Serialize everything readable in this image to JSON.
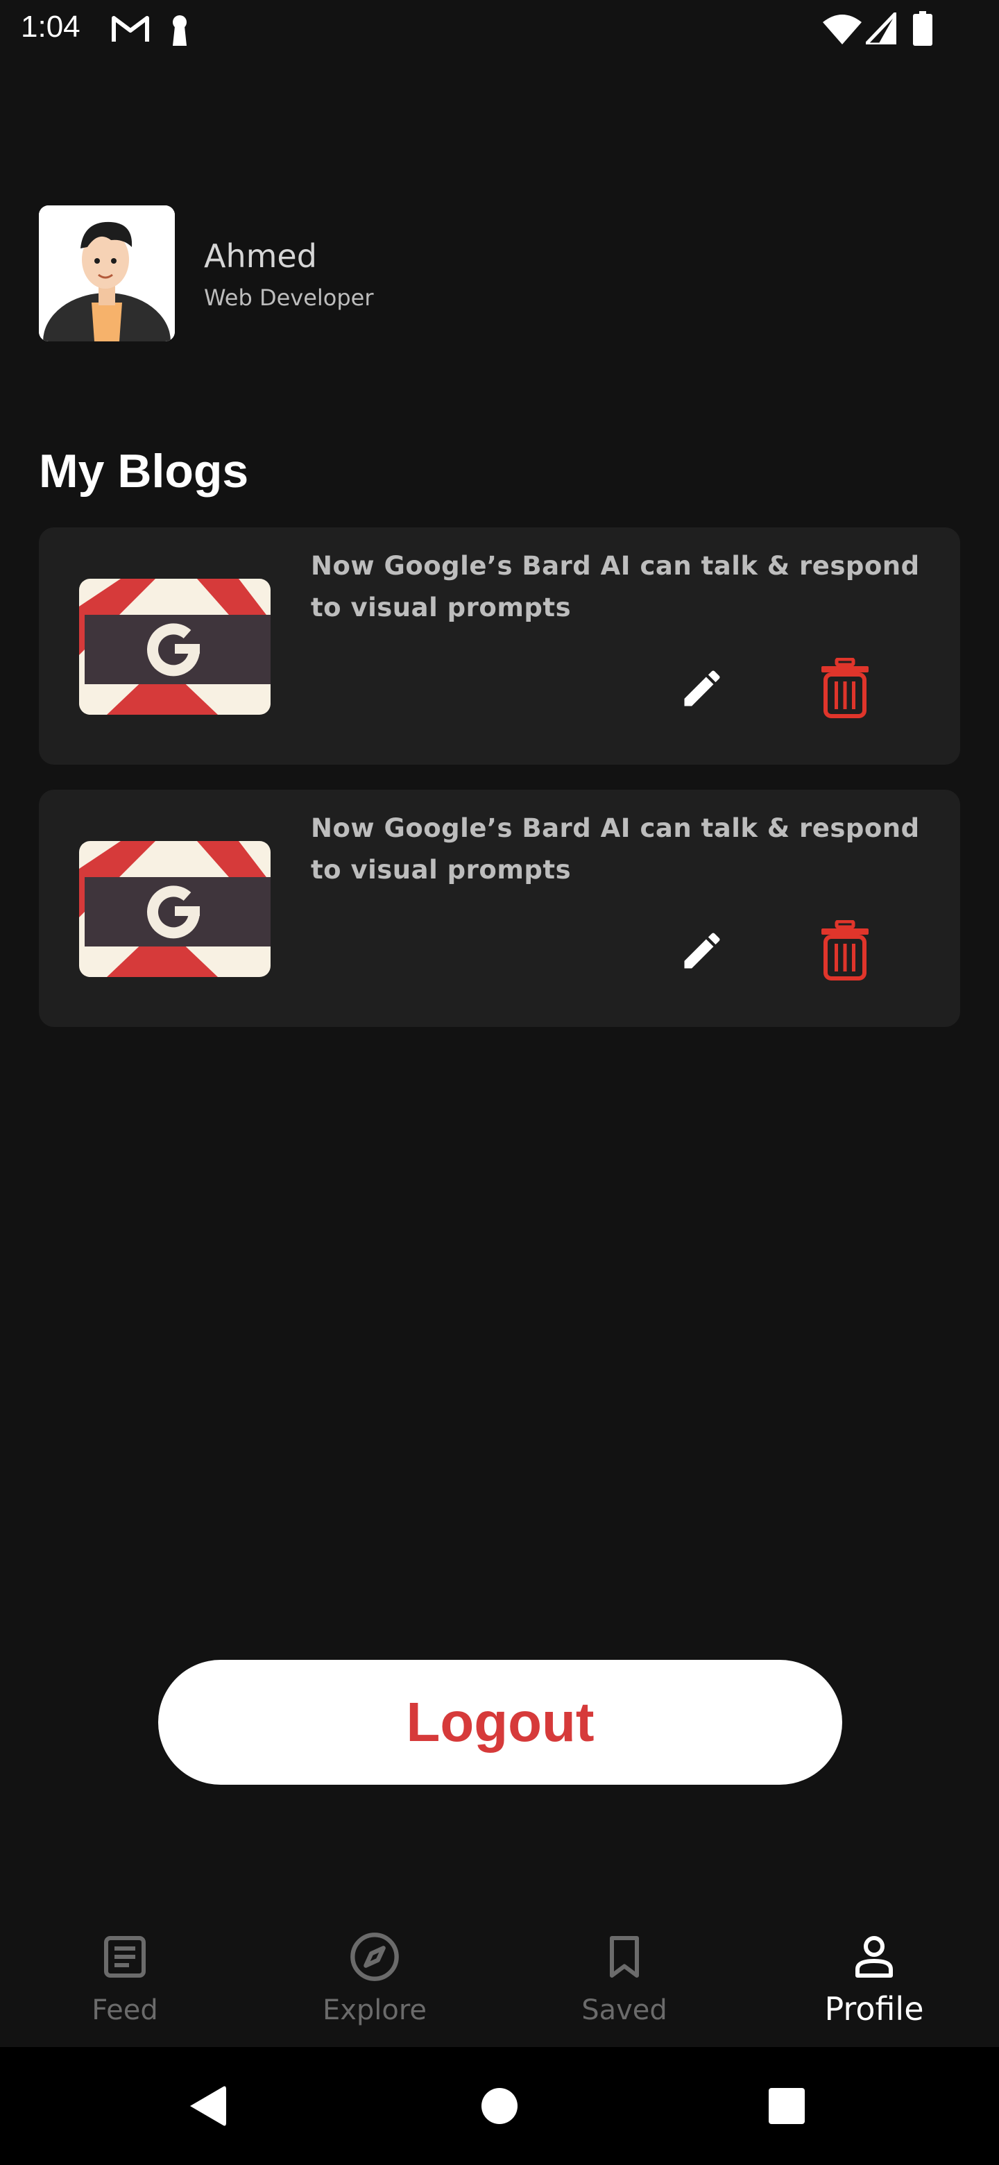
{
  "status_bar": {
    "time": "1:04",
    "icons": [
      "gmail-icon",
      "keyhole-icon",
      "wifi-icon",
      "signal-icon",
      "battery-icon"
    ]
  },
  "profile": {
    "name": "Ahmed",
    "role": "Web Developer",
    "avatar_icon": "user-avatar"
  },
  "section": {
    "title": "My Blogs"
  },
  "blogs": [
    {
      "title": "Now Google’s Bard AI can talk & respond to visual prompts",
      "thumbnail_icon": "google-g-logo",
      "edit_icon": "pencil-icon",
      "delete_icon": "trash-icon"
    },
    {
      "title": "Now Google’s Bard AI can talk & respond to visual prompts",
      "thumbnail_icon": "google-g-logo",
      "edit_icon": "pencil-icon",
      "delete_icon": "trash-icon"
    }
  ],
  "logout": {
    "label": "Logout"
  },
  "bottom_nav": {
    "items": [
      {
        "label": "Feed",
        "icon": "article-icon",
        "active": false
      },
      {
        "label": "Explore",
        "icon": "compass-icon",
        "active": false
      },
      {
        "label": "Saved",
        "icon": "bookmark-icon",
        "active": false
      },
      {
        "label": "Profile",
        "icon": "person-icon",
        "active": true
      }
    ]
  },
  "system_nav": {
    "icons": [
      "back-icon",
      "home-icon",
      "recents-icon"
    ]
  },
  "colors": {
    "background": "#121212",
    "card": "#1f1f1f",
    "accent_red": "#d63a3a",
    "nav_inactive": "#6b6b6b",
    "nav_active": "#ffffff"
  }
}
